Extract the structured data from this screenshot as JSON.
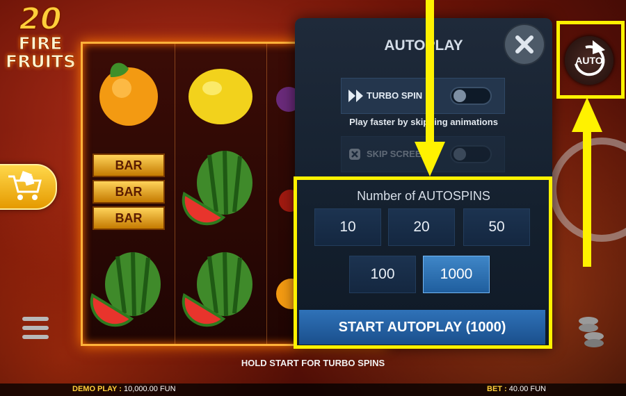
{
  "logo": {
    "number": "20",
    "line1": "FIRE",
    "line2": "FRUITS"
  },
  "reels": {
    "symbols": [
      [
        "orange-icon",
        "bar-icon",
        "watermelon-icon"
      ],
      [
        "lemon-icon",
        "watermelon-icon",
        "watermelon-icon"
      ],
      [
        "plum-icon",
        "cherry-icon",
        "orange-icon"
      ]
    ],
    "bar_label": "BAR"
  },
  "autoplay_panel": {
    "title": "AUTOPLAY",
    "turbo_spin": {
      "label": "TURBO SPIN",
      "enabled": false
    },
    "turbo_hint": "Play faster by skipping animations",
    "skip_screens": {
      "label": "SKIP SCREENS",
      "enabled": false,
      "disabled": true
    },
    "spins_title": "Number of AUTOSPINS",
    "options": [
      "10",
      "20",
      "50",
      "100",
      "1000"
    ],
    "selected": "1000",
    "start_label": "START AUTOPLAY (1000)"
  },
  "auto_button": {
    "label": "AUTO"
  },
  "hold_text": "HOLD START FOR TURBO SPINS",
  "footer": {
    "demo_label": "DEMO PLAY :",
    "demo_value": "10,000.00 FUN",
    "bet_label": "BET :",
    "bet_value": "40.00 FUN"
  },
  "colors": {
    "highlight": "#fff200",
    "selected_button": "#3f86c7",
    "start_button": "#2f72b8",
    "gold": "#ffcf3a"
  }
}
